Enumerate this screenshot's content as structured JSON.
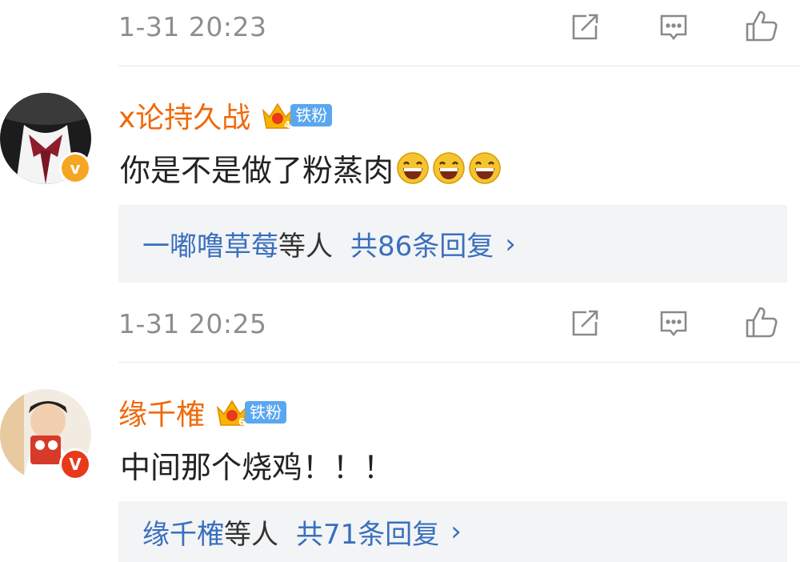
{
  "colors": {
    "name_orange": "#f0690a",
    "link_blue": "#3a6fbd",
    "time_gray": "#8e8e8e",
    "reply_bg": "#f3f4f6",
    "fan_badge_blue": "#5aa7f0",
    "verified_gold": "#f5a623",
    "verified_red": "#e8391b"
  },
  "top_meta": {
    "timestamp": "1-31 20:23",
    "icons": [
      "share-icon",
      "comment-icon",
      "like-icon"
    ]
  },
  "comments": [
    {
      "username": "x论持久战",
      "fan_level": "4",
      "fan_label": "铁粉",
      "verified_type": "gold",
      "verified_glyph": "v",
      "text": "你是不是做了粉蒸肉",
      "emoji_count": 3,
      "replies": {
        "names": "一嘟噜草莓",
        "tail": "等人",
        "count": "共86条回复",
        "chevron": "›"
      },
      "timestamp": "1-31 20:25"
    },
    {
      "username": "缘千榷",
      "fan_level": "6",
      "fan_label": "铁粉",
      "verified_type": "red",
      "verified_glyph": "V",
      "text": "中间那个烧鸡！！！",
      "replies": {
        "names": "缘千榷",
        "tail": "等人",
        "count": "共71条回复",
        "chevron": "›"
      }
    }
  ]
}
